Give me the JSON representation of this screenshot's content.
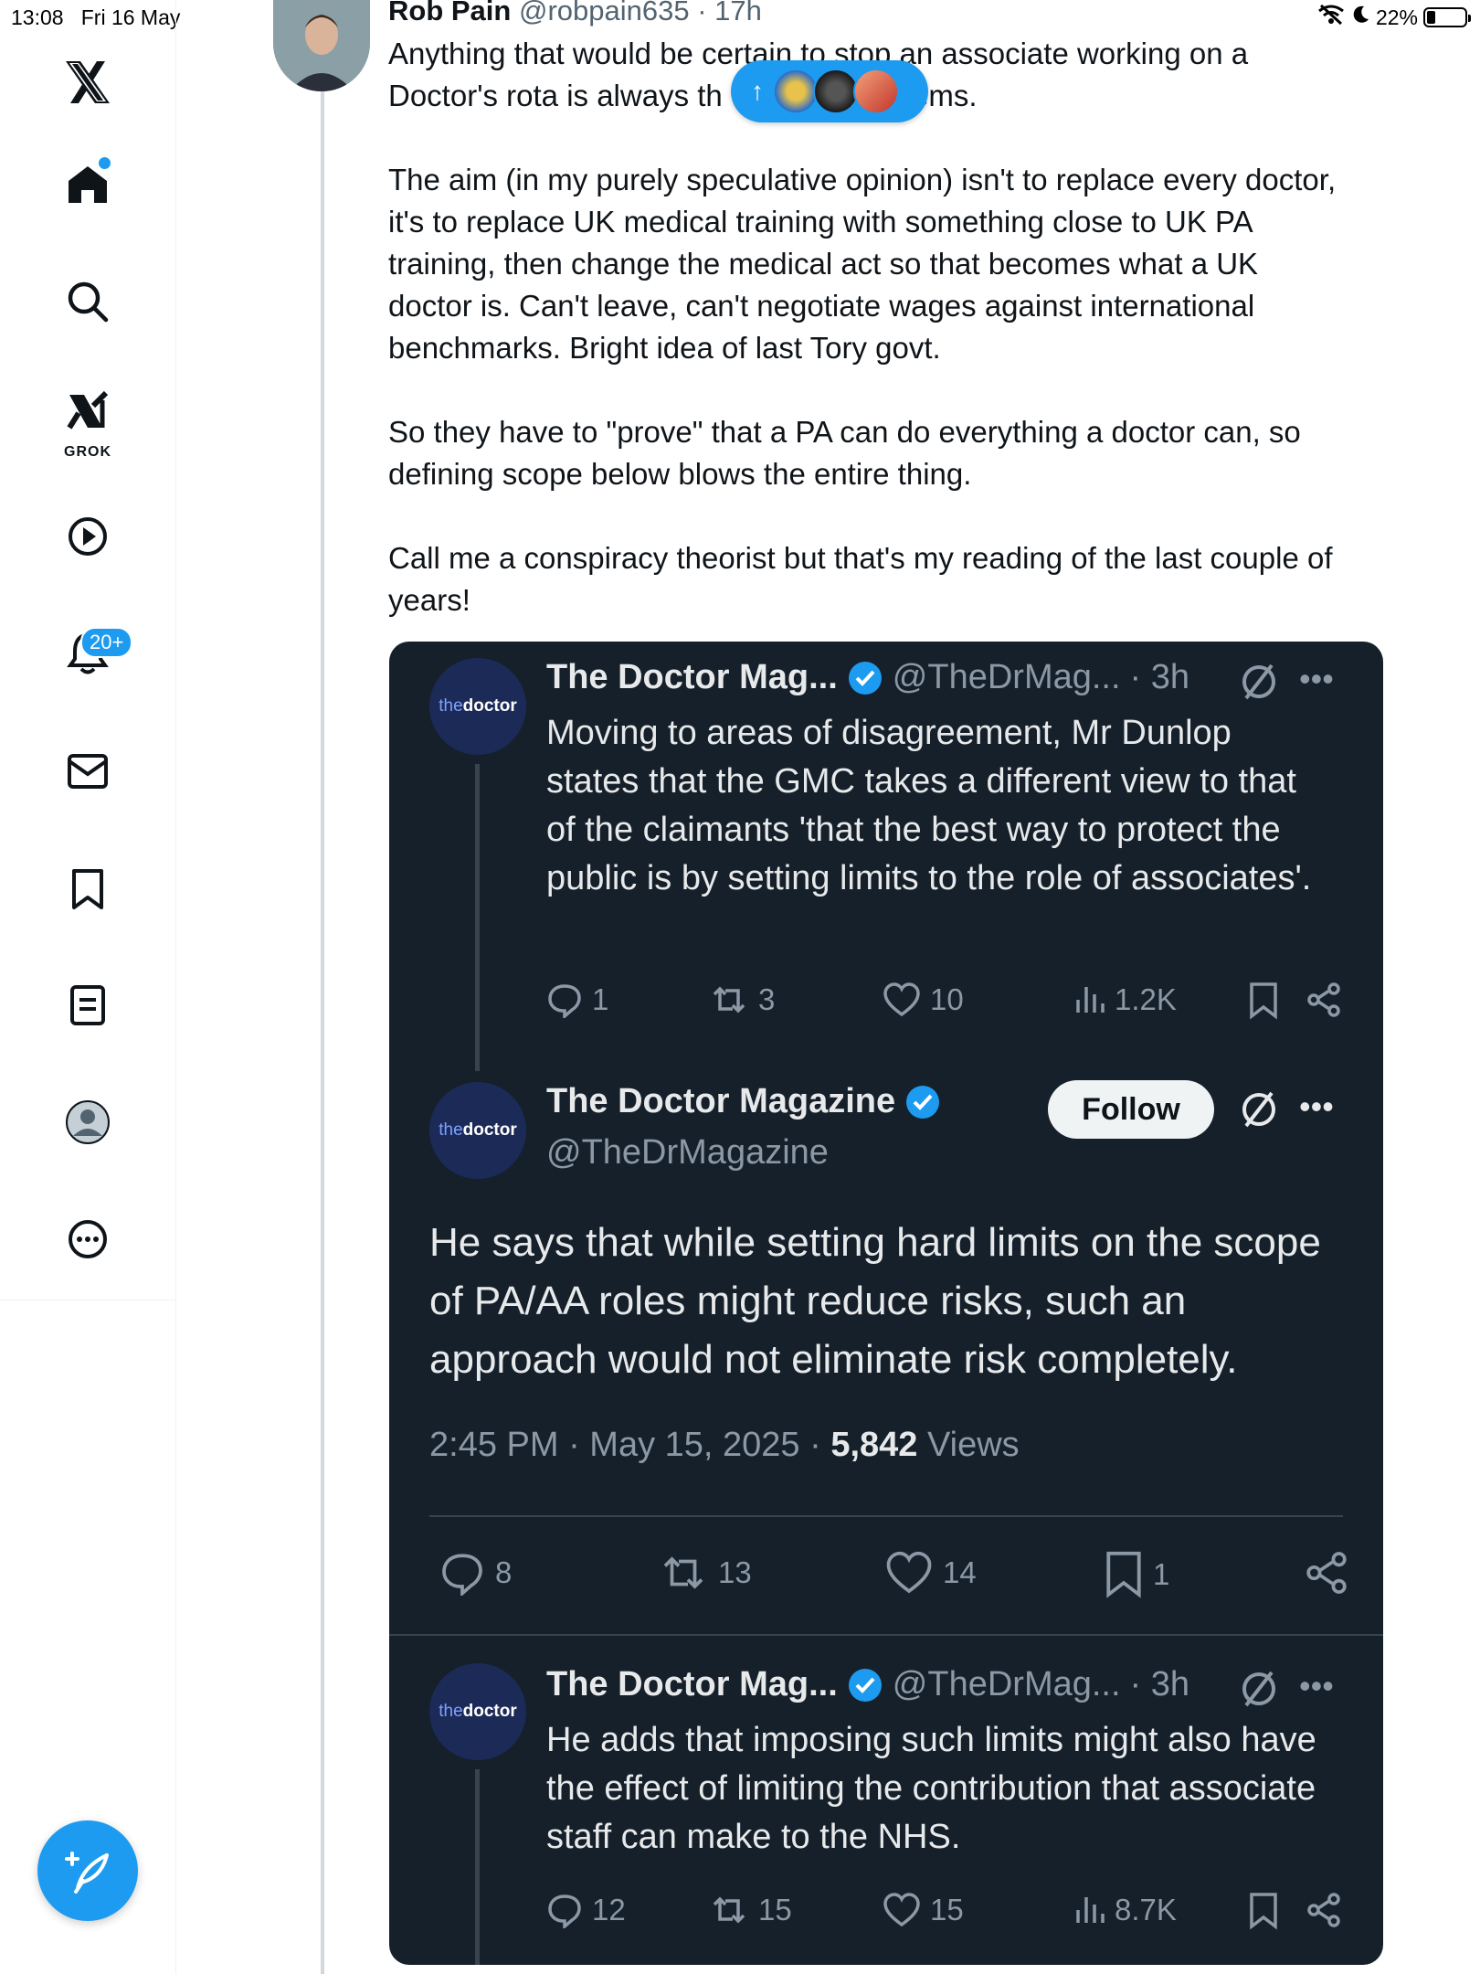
{
  "status_bar": {
    "time": "13:08",
    "date": "Fri 16 May",
    "battery": "22%"
  },
  "sidebar": {
    "notifications_badge": "20+",
    "grok_label": "GROK",
    "items": [
      "x-logo",
      "home",
      "explore",
      "grok",
      "video",
      "notifications",
      "messages",
      "bookmarks",
      "lists",
      "profile",
      "more"
    ]
  },
  "new_posts_pill": {
    "arrow": "↑"
  },
  "main_tweet": {
    "name": "Rob Pain",
    "handle": "@robpain635",
    "time": "17h",
    "text": "Anything that would be certain to stop an associate working on a\nDoctor's rota is always th             e it seems.\n\nThe aim (in my purely speculative opinion) isn't to replace every doctor,\nit's to replace UK medical training with something close to UK PA\ntraining, then change the medical act so that becomes what a UK\ndoctor is. Can't leave, can't negotiate wages against international\nbenchmarks. Bright idea of last Tory govt.\n\nSo they have to \"prove\" that a PA can do everything a doctor can, so\ndefining scope below blows the entire thing.\n\nCall me a conspiracy theorist but that's my reading of the last couple of\nyears!"
  },
  "embedded": {
    "avatar_the": "the",
    "avatar_doctor": "doctor",
    "tweet1": {
      "name": "The Doctor Mag...",
      "handle": "@TheDrMag...",
      "time": "· 3h",
      "text": "Moving to areas of disagreement, Mr Dunlop states that the GMC takes a different view to that of the claimants 'that the best way to protect the public is by setting limits to the role of associates'.",
      "replies": "1",
      "reposts": "3",
      "likes": "10",
      "views": "1.2K"
    },
    "tweet2": {
      "name": "The Doctor Magazine",
      "handle": "@TheDrMagazine",
      "follow_label": "Follow",
      "text": "He says that while setting hard limits on the scope of PA/AA roles might reduce risks, such an approach would not eliminate risk completely.",
      "timestamp": "2:45 PM · May 15, 2025 · ",
      "views_count": "5,842",
      "views_label": " Views",
      "replies": "8",
      "reposts": "13",
      "likes": "14",
      "bookmarks": "1"
    },
    "tweet3": {
      "name": "The Doctor Mag...",
      "handle": "@TheDrMag...",
      "time": "· 3h",
      "text": "He adds that imposing such limits might also have the effect of limiting the contribution that associate staff can make to the NHS.",
      "replies": "12",
      "reposts": "15",
      "likes": "15",
      "views": "8.7K"
    }
  },
  "colors": {
    "accent": "#1d9bf0",
    "card_bg": "#15202b",
    "muted": "#8b98a5"
  }
}
